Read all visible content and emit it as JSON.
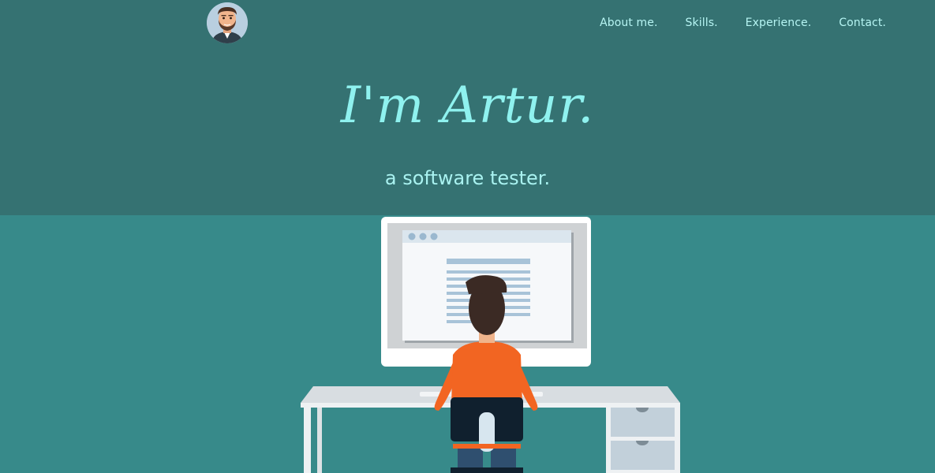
{
  "nav": {
    "items": [
      {
        "label": "About me."
      },
      {
        "label": "Skills."
      },
      {
        "label": "Experience."
      },
      {
        "label": "Contact."
      }
    ]
  },
  "hero": {
    "title": "I'm Artur.",
    "subtitle": "a software tester."
  },
  "colors": {
    "hero_bg": "#357272",
    "scene_bg": "#378a8a",
    "title": "#8ff2ef",
    "nav_text": "#b6f5f3",
    "shirt": "#f26522",
    "hair": "#3b2a24"
  },
  "illustration": {
    "subject": "person-at-computer-illustration"
  }
}
